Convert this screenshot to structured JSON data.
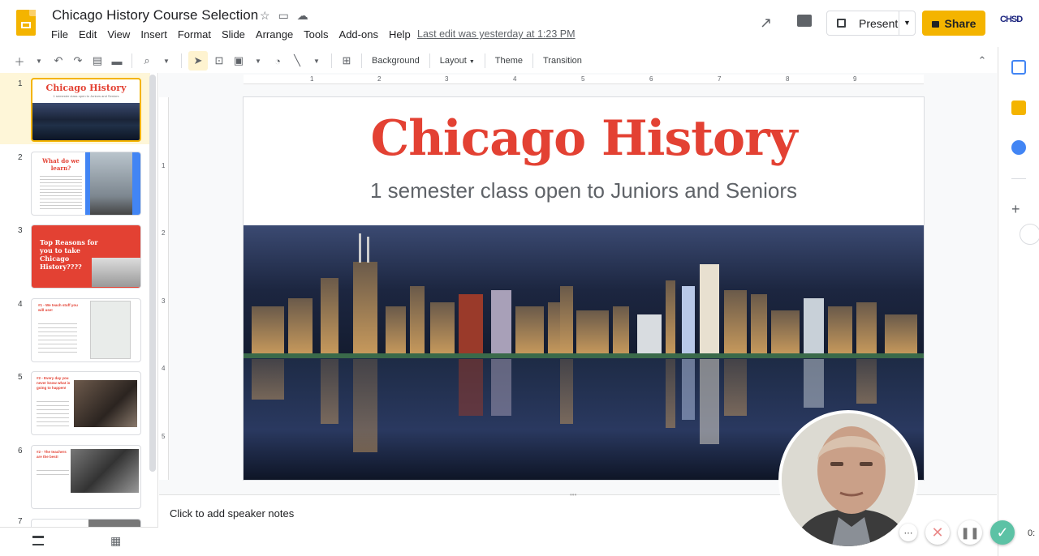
{
  "doc": {
    "title": "Chicago History Course Selection",
    "last_edit": "Last edit was yesterday at 1:23 PM"
  },
  "menu": [
    "File",
    "Edit",
    "View",
    "Insert",
    "Format",
    "Slide",
    "Arrange",
    "Tools",
    "Add-ons",
    "Help"
  ],
  "header": {
    "present_label": "Present",
    "share_label": "Share",
    "account_label": "CHSD"
  },
  "toolbar": {
    "background_label": "Background",
    "layout_label": "Layout",
    "theme_label": "Theme",
    "transition_label": "Transition"
  },
  "filmstrip": {
    "slides": [
      {
        "num": "1",
        "title": "Chicago History",
        "subtitle": "1 semester class open to Juniors and Seniors"
      },
      {
        "num": "2",
        "title": "What do we learn?"
      },
      {
        "num": "3",
        "title": "Top Reasons for you to take Chicago History????"
      },
      {
        "num": "4",
        "title": "#1 - We teach stuff you will use!"
      },
      {
        "num": "5",
        "title": "#2 - Every day you never know what is going to happen!"
      },
      {
        "num": "6",
        "title": "#2 - The teachers are the best!"
      },
      {
        "num": "7",
        "title": ""
      }
    ]
  },
  "ruler": {
    "h_ticks": [
      "1",
      "2",
      "3",
      "4",
      "5",
      "6",
      "7",
      "8",
      "9"
    ],
    "v_ticks": [
      "1",
      "2",
      "3",
      "4",
      "5"
    ]
  },
  "slide": {
    "title": "Chicago History",
    "subtitle": "1 semester class open to Juniors and Seniors",
    "title_color": "#e34133"
  },
  "notes": {
    "placeholder": "Click to add speaker notes"
  },
  "recorder": {
    "timer": "0:"
  },
  "colors": {
    "accent": "#f4b400",
    "done": "#5cc2a5"
  }
}
